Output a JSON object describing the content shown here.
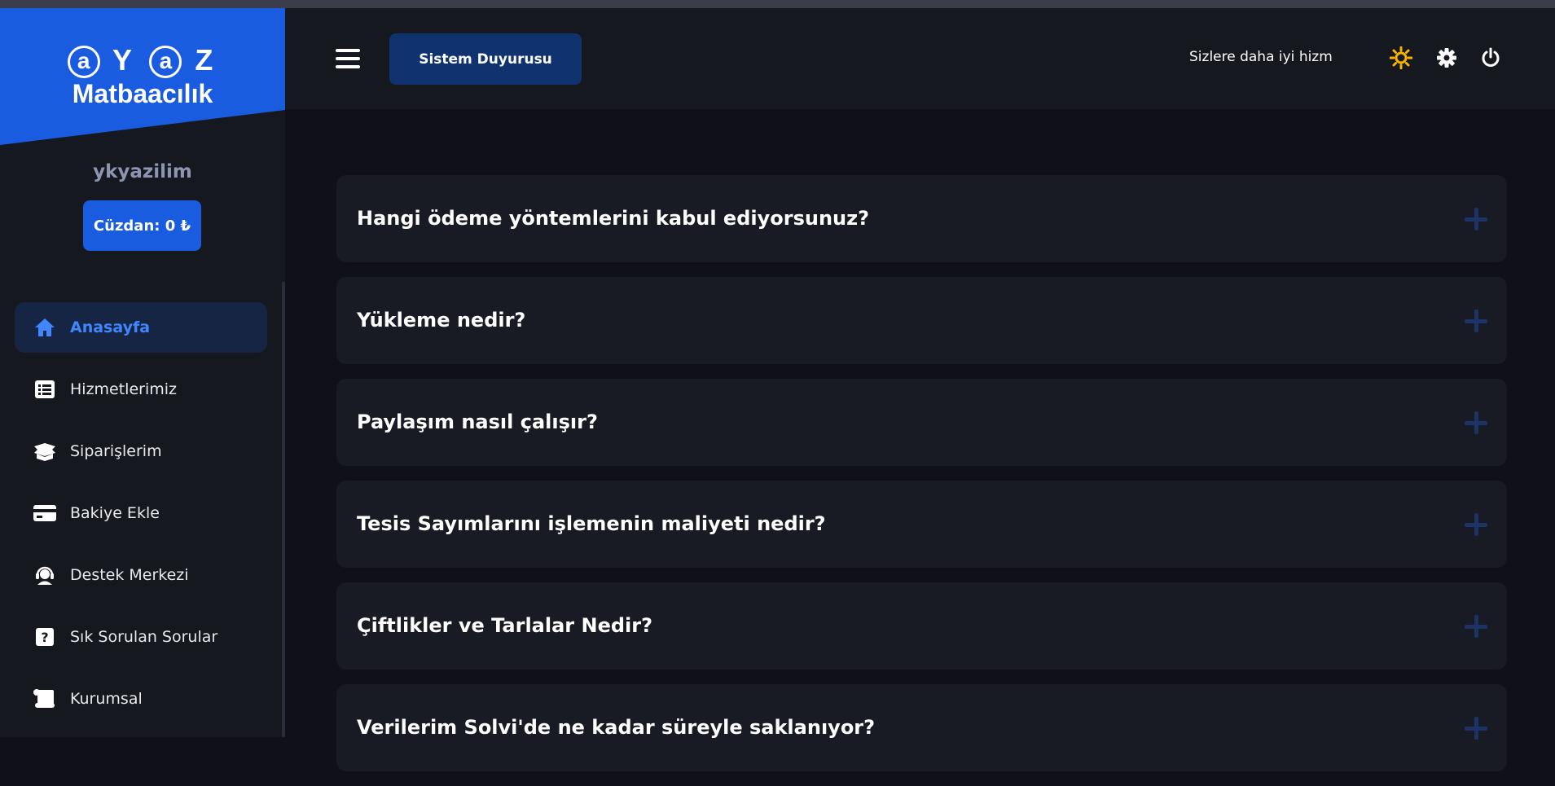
{
  "brand": {
    "logo_letters": [
      "a",
      "Y",
      "a",
      "Z"
    ],
    "logo_word": "Matbaacılık",
    "accent": "#1a5ce0"
  },
  "user": {
    "name": "ykyazilim",
    "wallet": "Cüzdan: 0 ₺"
  },
  "nav": [
    {
      "label": "Anasayfa",
      "icon": "home-icon",
      "active": true
    },
    {
      "label": "Hizmetlerimiz",
      "icon": "list-icon"
    },
    {
      "label": "Siparişlerim",
      "icon": "box-icon"
    },
    {
      "label": "Bakiye Ekle",
      "icon": "credit-card-icon"
    },
    {
      "label": "Destek Merkezi",
      "icon": "headset-icon"
    },
    {
      "label": "Sık Sorulan Sorular",
      "icon": "question-icon"
    },
    {
      "label": "Kurumsal",
      "icon": "scroll-icon"
    }
  ],
  "header": {
    "announce_label": "Sistem Duyurusu",
    "marquee_text": "Sizlere daha iyi hizm",
    "icons": [
      "sun-icon",
      "gear-icon",
      "power-icon"
    ],
    "sun_color": "#f7b500"
  },
  "faq": [
    {
      "question": "Hangi ödeme yöntemlerini kabul ediyorsunuz?"
    },
    {
      "question": "Yükleme nedir?"
    },
    {
      "question": "Paylaşım nasıl çalışır?"
    },
    {
      "question": "Tesis Sayımlarını işlemenin maliyeti nedir?"
    },
    {
      "question": "Çiftlikler ve Tarlalar Nedir?"
    },
    {
      "question": "Verilerim Solvi'de ne kadar süreyle saklanıyor?"
    }
  ]
}
